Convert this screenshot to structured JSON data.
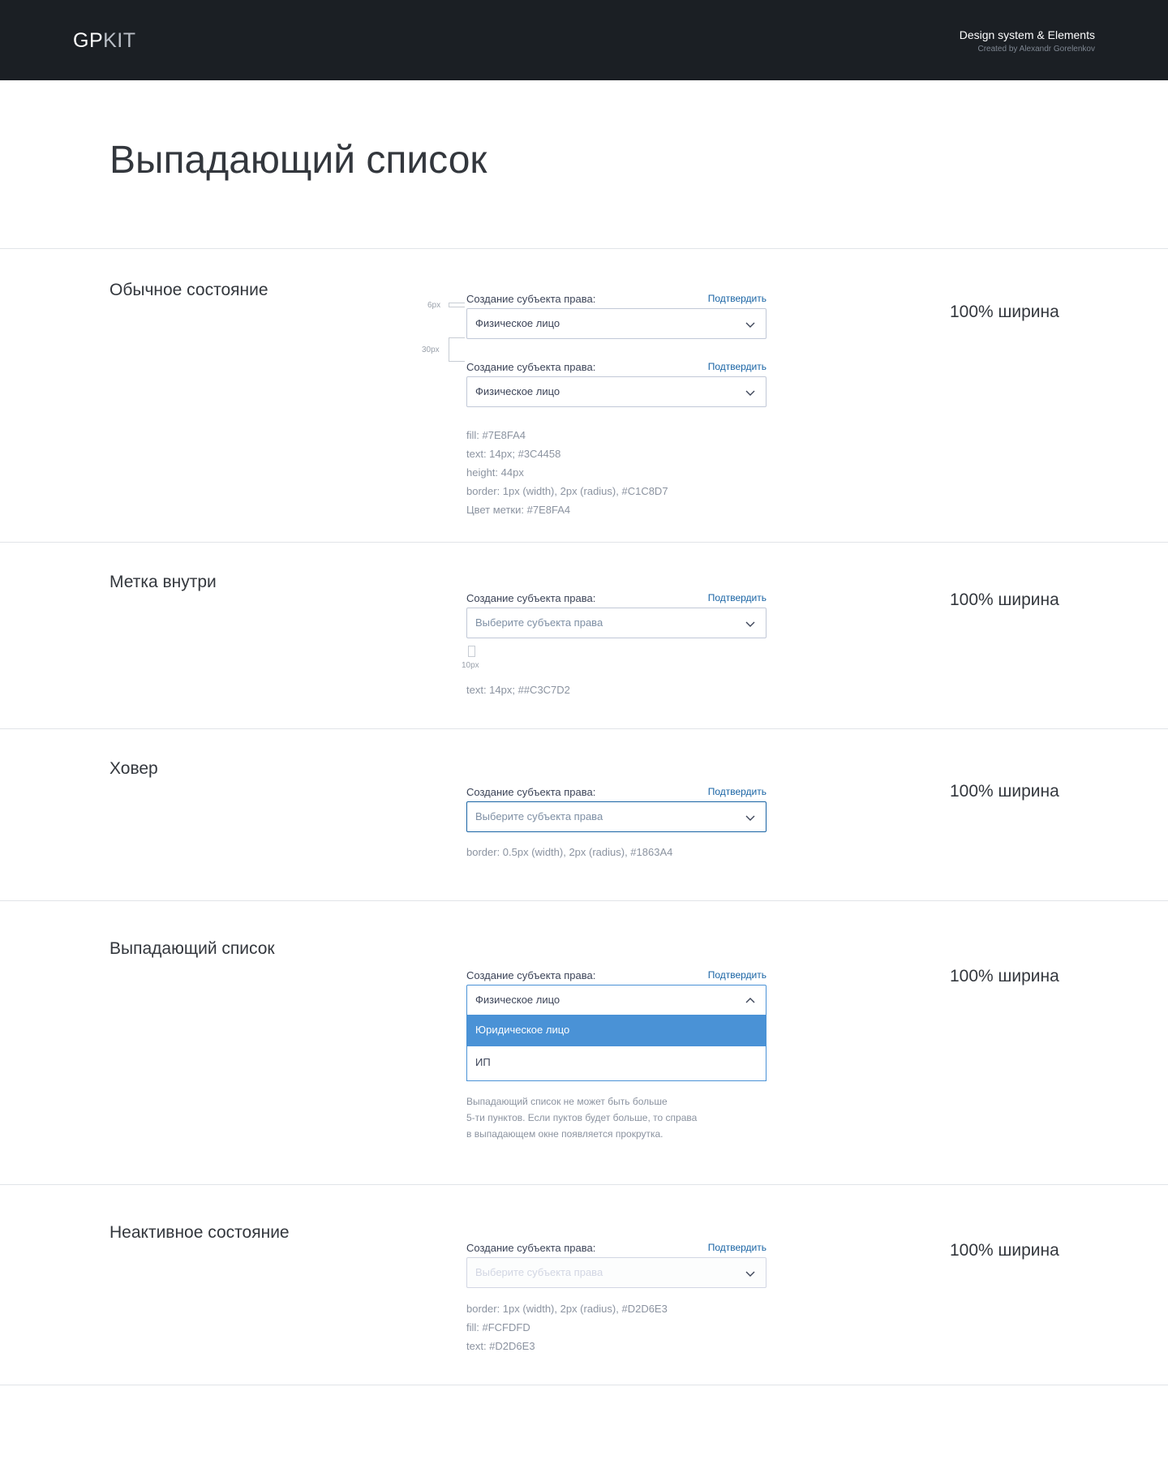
{
  "header": {
    "logo_bold": "GP",
    "logo_light": "KIT",
    "title": "Design system & Elements",
    "subtitle": "Created by Alexandr Gorelenkov"
  },
  "page": {
    "title": "Выпадающий список"
  },
  "common": {
    "field_label": "Создание субъекта права:",
    "confirm_label": "Подтвердить",
    "width_note": "100% ширина",
    "chevron_icon": "chevron-down-icon",
    "chevron_up_icon": "chevron-up-icon"
  },
  "sections": {
    "normal": {
      "title": "Обычное состояние",
      "value": "Физическое лицо",
      "dim_label_gap": "6px",
      "dim_field_gap": "30px",
      "specs": [
        "fill: #7E8FA4",
        "text: 14px; #3C4458",
        "height: 44px",
        "border: 1px (width), 2px (radius), #C1C8D7",
        "Цвет метки: #7E8FA4"
      ]
    },
    "inside": {
      "title": "Метка внутри",
      "placeholder": "Выберите субъекта права",
      "dim_padding": "10px",
      "specs": [
        "text: 14px; ##C3C7D2"
      ]
    },
    "hover": {
      "title": "Ховер",
      "placeholder": "Выберите субъекта права",
      "specs": [
        "border: 0.5px (width), 2px (radius), #1863A4"
      ]
    },
    "dropdown": {
      "title": "Выпадающий список",
      "value": "Физическое лицо",
      "options": [
        "Юридическое лицо",
        "ИП"
      ],
      "specs": [
        "Выпадающий список не может быть больше",
        "5-ти пунктов. Если пуктов будет больше, то справа",
        "в выпадающем окне появляется прокрутка."
      ]
    },
    "disabled": {
      "title": "Неактивное состояние",
      "placeholder": "Выберите субъекта права",
      "specs": [
        "border: 1px (width), 2px (radius), #D2D6E3",
        "fill: #FCFDFD",
        "text: #D2D6E3"
      ]
    }
  },
  "colors": {
    "header_bg": "#1B1F24",
    "label": "#3C4458",
    "link": "#1863A4",
    "border": "#C1C8D7",
    "placeholder": "#7E8FA4",
    "option_active": "#4A92D6",
    "disabled_border": "#D2D6E3",
    "disabled_fill": "#FCFDFD"
  }
}
